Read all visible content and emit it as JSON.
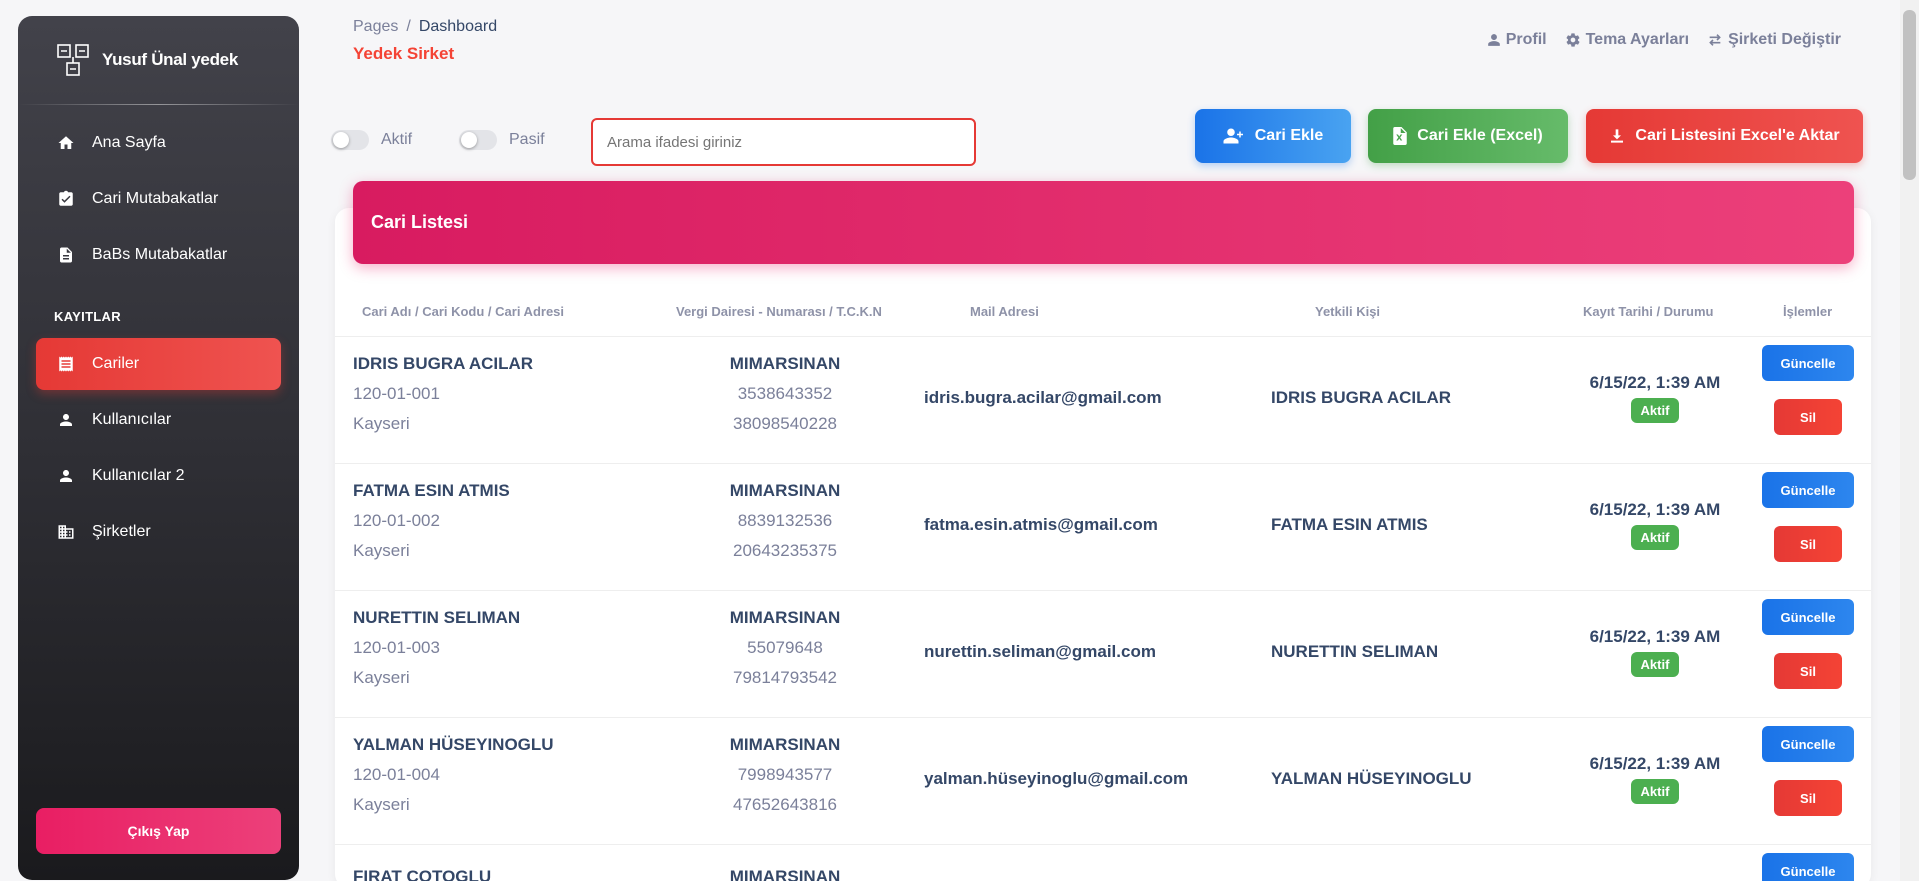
{
  "sidebar": {
    "brand": "Yusuf Ünal yedek",
    "items": [
      {
        "label": "Ana Sayfa",
        "icon": "home-icon"
      },
      {
        "label": "Cari Mutabakatlar",
        "icon": "clipboard-check-icon"
      },
      {
        "label": "BaBs Mutabakatlar",
        "icon": "document-icon"
      }
    ],
    "section_title": "KAYITLAR",
    "records": [
      {
        "label": "Cariler",
        "icon": "receipt-icon",
        "active": true
      },
      {
        "label": "Kullanıcılar",
        "icon": "user-icon"
      },
      {
        "label": "Kullanıcılar 2",
        "icon": "user-icon"
      },
      {
        "label": "Şirketler",
        "icon": "building-icon"
      }
    ],
    "logout": "Çıkış Yap"
  },
  "header": {
    "breadcrumb_root": "Pages",
    "breadcrumb_sep": "/",
    "breadcrumb_current": "Dashboard",
    "title": "Yedek Sirket",
    "links": {
      "profile": "Profil",
      "theme": "Tema Ayarları",
      "switch_company": "Şirketi Değiştir"
    }
  },
  "filters": {
    "active_label": "Aktif",
    "passive_label": "Pasif",
    "search_placeholder": "Arama ifadesi giriniz"
  },
  "actions": {
    "add": "Cari Ekle",
    "add_excel": "Cari Ekle (Excel)",
    "export_excel": "Cari Listesini Excel'e Aktar"
  },
  "table": {
    "title": "Cari Listesi",
    "columns": {
      "name": "Cari Adı / Cari Kodu / Cari Adresi",
      "tax": "Vergi Dairesi - Numarası / T.C.K.N",
      "mail": "Mail Adresi",
      "contact": "Yetkili Kişi",
      "date": "Kayıt Tarihi / Durumu",
      "ops": "İşlemler"
    },
    "update_label": "Güncelle",
    "delete_label": "Sil",
    "rows": [
      {
        "name": "IDRIS BUGRA ACILAR",
        "code": "120-01-001",
        "address": "Kayseri",
        "tax_office": "MIMARSINAN",
        "tax_no": "3538643352",
        "tckn": "38098540228",
        "mail": "idris.bugra.acilar@gmail.com",
        "contact": "IDRIS BUGRA ACILAR",
        "date": "6/15/22, 1:39 AM",
        "status": "Aktif"
      },
      {
        "name": "FATMA ESIN ATMIS",
        "code": "120-01-002",
        "address": "Kayseri",
        "tax_office": "MIMARSINAN",
        "tax_no": "8839132536",
        "tckn": "20643235375",
        "mail": "fatma.esin.atmis@gmail.com",
        "contact": "FATMA ESIN ATMIS",
        "date": "6/15/22, 1:39 AM",
        "status": "Aktif"
      },
      {
        "name": "NURETTIN SELIMAN",
        "code": "120-01-003",
        "address": "Kayseri",
        "tax_office": "MIMARSINAN",
        "tax_no": "55079648",
        "tckn": "79814793542",
        "mail": "nurettin.seliman@gmail.com",
        "contact": "NURETTIN SELIMAN",
        "date": "6/15/22, 1:39 AM",
        "status": "Aktif"
      },
      {
        "name": "YALMAN HÜSEYINOGLU",
        "code": "120-01-004",
        "address": "Kayseri",
        "tax_office": "MIMARSINAN",
        "tax_no": "7998943577",
        "tckn": "47652643816",
        "mail": "yalman.hüseyinoglu@gmail.com",
        "contact": "YALMAN HÜSEYINOGLU",
        "date": "6/15/22, 1:39 AM",
        "status": "Aktif"
      },
      {
        "name": "FIRAT COTOGLU",
        "tax_office": "MIMARSINAN"
      }
    ]
  },
  "colors": {
    "accent_red": "#e53935",
    "pink": "#e91e63",
    "blue": "#1a73e8",
    "green": "#43a047"
  }
}
